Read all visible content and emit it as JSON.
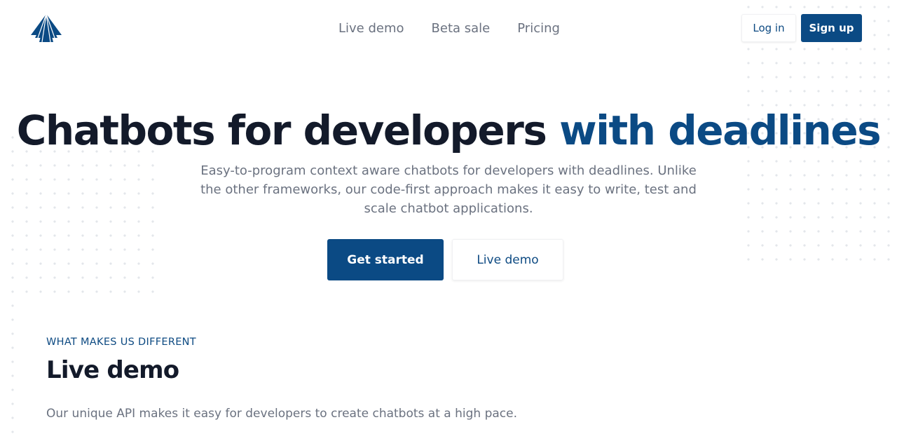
{
  "header": {
    "nav": [
      {
        "label": "Live demo"
      },
      {
        "label": "Beta sale"
      },
      {
        "label": "Pricing"
      }
    ],
    "login_label": "Log in",
    "signup_label": "Sign up"
  },
  "hero": {
    "title_main": "Chatbots for developers ",
    "title_accent": "with deadlines",
    "subtitle": "Easy-to-program context aware chatbots for developers with deadlines. Unlike the other frameworks, our code-first approach makes it easy to write, test and scale chatbot applications.",
    "primary_cta": "Get started",
    "secondary_cta": "Live demo"
  },
  "section": {
    "eyebrow": "WHAT MAKES US DIFFERENT",
    "title": "Live demo",
    "description": "Our unique API makes it easy for developers to create chatbots at a high pace."
  },
  "colors": {
    "brand": "#0b4a84",
    "heading": "#131a2a",
    "muted": "#6b7280"
  },
  "icons": {
    "logo": "triangle-logo-icon"
  }
}
